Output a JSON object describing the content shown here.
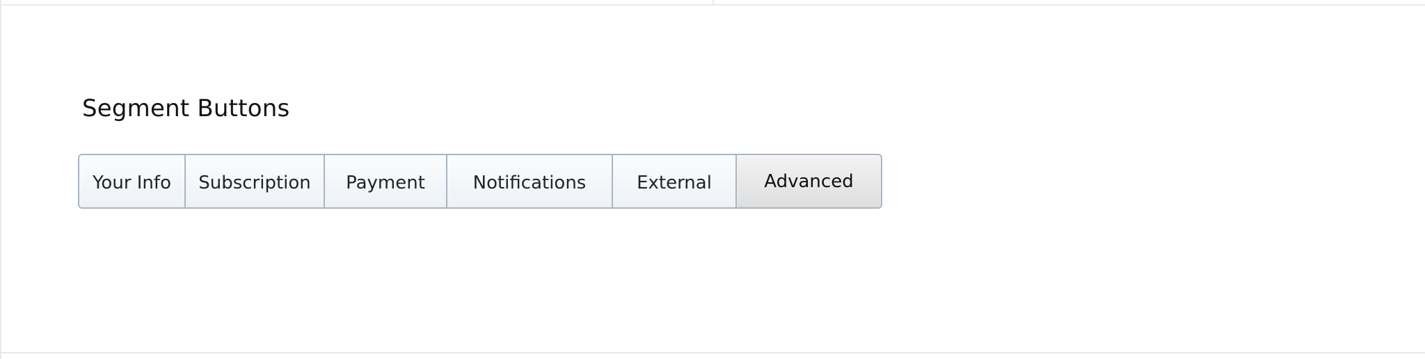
{
  "section": {
    "title": "Segment Buttons"
  },
  "segments": {
    "items": [
      {
        "label": "Your Info",
        "selected": false
      },
      {
        "label": "Subscription",
        "selected": false
      },
      {
        "label": "Payment",
        "selected": false
      },
      {
        "label": "Notifications",
        "selected": false
      },
      {
        "label": "External",
        "selected": false
      },
      {
        "label": "Advanced",
        "selected": true
      }
    ]
  },
  "colors": {
    "segment_border": "#a8b6c3",
    "segment_bg_top": "#fbfcfd",
    "segment_bg_bottom": "#eef2f6",
    "active_bg_top": "#f3f3f3",
    "active_bg_bottom": "#dedede",
    "frame_lines": "#e7e9ec"
  }
}
